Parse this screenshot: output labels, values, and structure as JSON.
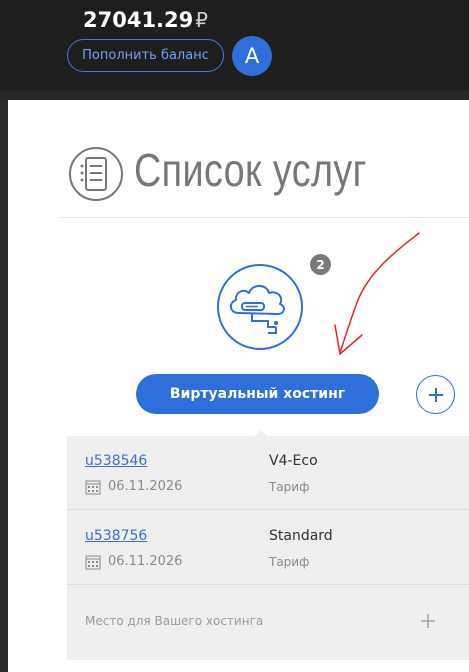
{
  "header": {
    "balance": "27041.29",
    "currency_symbol": "₽",
    "topup_label": "Пополнить баланс",
    "avatar_initial": "A"
  },
  "page": {
    "title": "Список услуг"
  },
  "service": {
    "count_badge": "2",
    "button_label": "Виртуальный хостинг"
  },
  "hosting_list": {
    "rows": [
      {
        "login": "u538546",
        "date": "06.11.2026",
        "plan": "V4-Eco",
        "plan_caption": "Тариф"
      },
      {
        "login": "u538756",
        "date": "06.11.2026",
        "plan": "Standard",
        "plan_caption": "Тариф"
      }
    ],
    "placeholder_label": "Место для Вашего хостинга"
  },
  "colors": {
    "accent": "#2f6fda",
    "annotation_arrow": "#e0261f"
  }
}
